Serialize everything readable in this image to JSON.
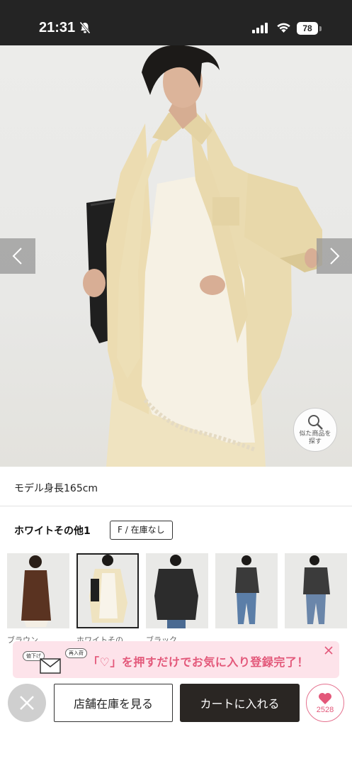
{
  "status_bar": {
    "time": "21:31",
    "battery": "78",
    "icons": [
      "bell-off-icon",
      "signal-icon",
      "wifi-icon",
      "battery-icon"
    ]
  },
  "hero": {
    "image": "model wearing cream oversized shirt over ivory lace camisole holding black tote bag",
    "prev_icon": "chevron-left-icon",
    "next_icon": "chevron-right-icon",
    "similar_label": "似た商品を探す"
  },
  "product": {
    "model_height": "モデル身長165cm",
    "color_name": "ホワイトその他1",
    "size_stock": "F / 在庫なし"
  },
  "thumbnails": [
    {
      "label": "ブラウン",
      "color": "#5a3321",
      "selected": false
    },
    {
      "label": "ホワイトその",
      "color": "#efe7cf",
      "selected": true
    },
    {
      "label": "ブラック",
      "color": "#2c2c2c",
      "selected": false
    },
    {
      "label": "",
      "color": "#3a3a3a",
      "selected": false
    },
    {
      "label": "",
      "color": "#3b3b3b",
      "selected": false
    }
  ],
  "toast": {
    "bubble_left": "値下げ",
    "bubble_right": "再入荷",
    "message": "「♡」を押すだけでお気に入り登録完了！"
  },
  "actions": {
    "store_stock": "店舗在庫を見る",
    "add_to_cart": "カートに入れる",
    "favorite_count": "2528"
  },
  "colors": {
    "status_bar_bg": "#242424",
    "cart_bg": "#2a2623",
    "accent_pink": "#e3587a",
    "toast_bg": "#fde3ea"
  }
}
